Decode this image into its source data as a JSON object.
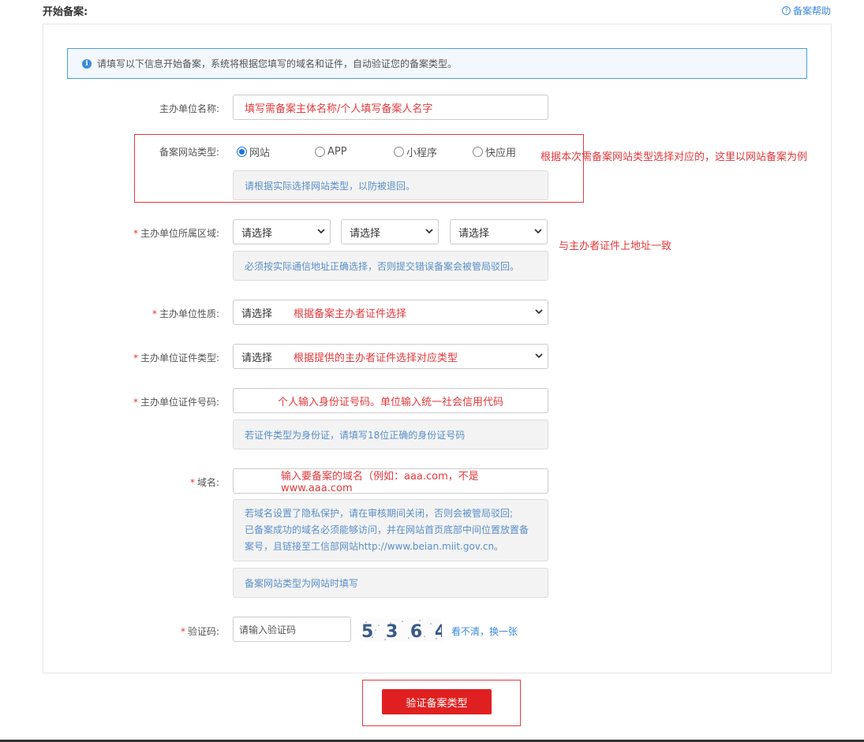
{
  "header": {
    "title": "开始备案:",
    "help_label": "备案帮助",
    "help_icon": "?"
  },
  "banner": {
    "icon": "i",
    "text": "请填写以下信息开始备案，系统将根据您填写的域名和证件，自动验证您的备案类型。"
  },
  "fields": {
    "org_name": {
      "label": "主办单位名称:",
      "value": "填写需备案主体名称/个人填写备案人名字"
    },
    "site_type": {
      "label": "备案网站类型:",
      "options": [
        "网站",
        "APP",
        "小程序",
        "快应用"
      ],
      "selected": "网站",
      "hint": "请根据实际选择网站类型，以防被退回。"
    },
    "region": {
      "required": "*",
      "label": "主办单位所属区域:",
      "selects": [
        "请选择",
        "请选择",
        "请选择"
      ],
      "hint": "必须按实际通信地址正确选择，否则提交错误备案会被管局驳回。"
    },
    "org_nature": {
      "required": "*",
      "label": "主办单位性质:",
      "value": "请选择"
    },
    "cert_type": {
      "required": "*",
      "label": "主办单位证件类型:",
      "value": "请选择"
    },
    "cert_no": {
      "required": "*",
      "label": "主办单位证件号码:",
      "hint": "若证件类型为身份证，请填写18位正确的身份证号码"
    },
    "domain": {
      "required": "*",
      "label": "域名:",
      "hint_lines": [
        "若域名设置了隐私保护，请在审核期间关闭，否则会被管局驳回;",
        "已备案成功的域名必须能够访问，并在网站首页底部中间位置放置备",
        "案号，且链接至工信部网站http://www.beian.miit.gov.cn。"
      ],
      "hint2": "备案网站类型为网站时填写"
    },
    "captcha": {
      "required": "*",
      "label": "验证码:",
      "placeholder": "请输入验证码",
      "image_text": "5 3 6 4",
      "refresh_label": "看不清，换一张"
    }
  },
  "annotations": {
    "site_type": "根据本次需备案网站类型选择对应的，这里以网站备案为例",
    "region": "与主办者证件上地址一致",
    "org_nature": "根据备案主办者证件选择",
    "cert_type": "根据提供的主办者证件选择对应类型",
    "cert_no": "个人输入身份证号码。单位输入统一社会信用代码",
    "domain": "输入要备案的域名（例如：aaa.com，不是www.aaa.com"
  },
  "submit_label": "验证备案类型",
  "colors": {
    "accent": "#3b8ad9",
    "annotation": "#e4393c",
    "submit": "#e02020"
  }
}
